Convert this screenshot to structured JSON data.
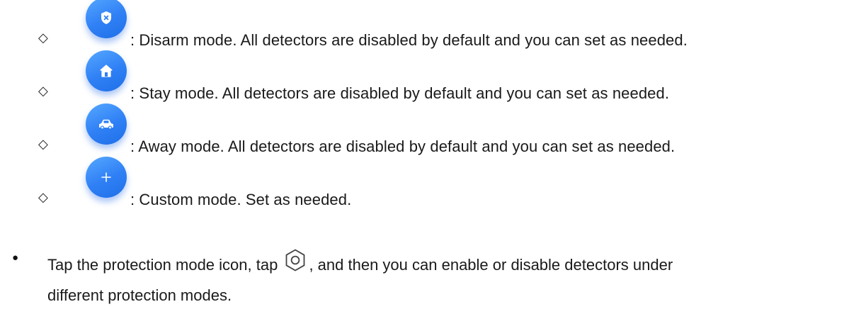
{
  "modes": [
    {
      "icon": "shield-x-icon",
      "text": ": Disarm mode. All detectors are disabled by default and you can set as needed."
    },
    {
      "icon": "home-icon",
      "text": ": Stay mode. All detectors are disabled by default and you can set as needed."
    },
    {
      "icon": "car-icon",
      "text": ": Away mode. All detectors are disabled by default and you can set as needed."
    },
    {
      "icon": "plus-icon",
      "text": ": Custom mode. Set as needed."
    }
  ],
  "bullet": {
    "marker": "●",
    "text_before": "Tap the protection mode icon, tap",
    "settings_icon": "settings-icon",
    "text_after": ", and then you can enable or disable detectors under",
    "text_line2": "different protection modes."
  },
  "sub_marker": "◇",
  "colors": {
    "icon_blue": "#2f7ff5",
    "icon_blue_light": "#55a8ff",
    "text": "#1a1a1a"
  }
}
